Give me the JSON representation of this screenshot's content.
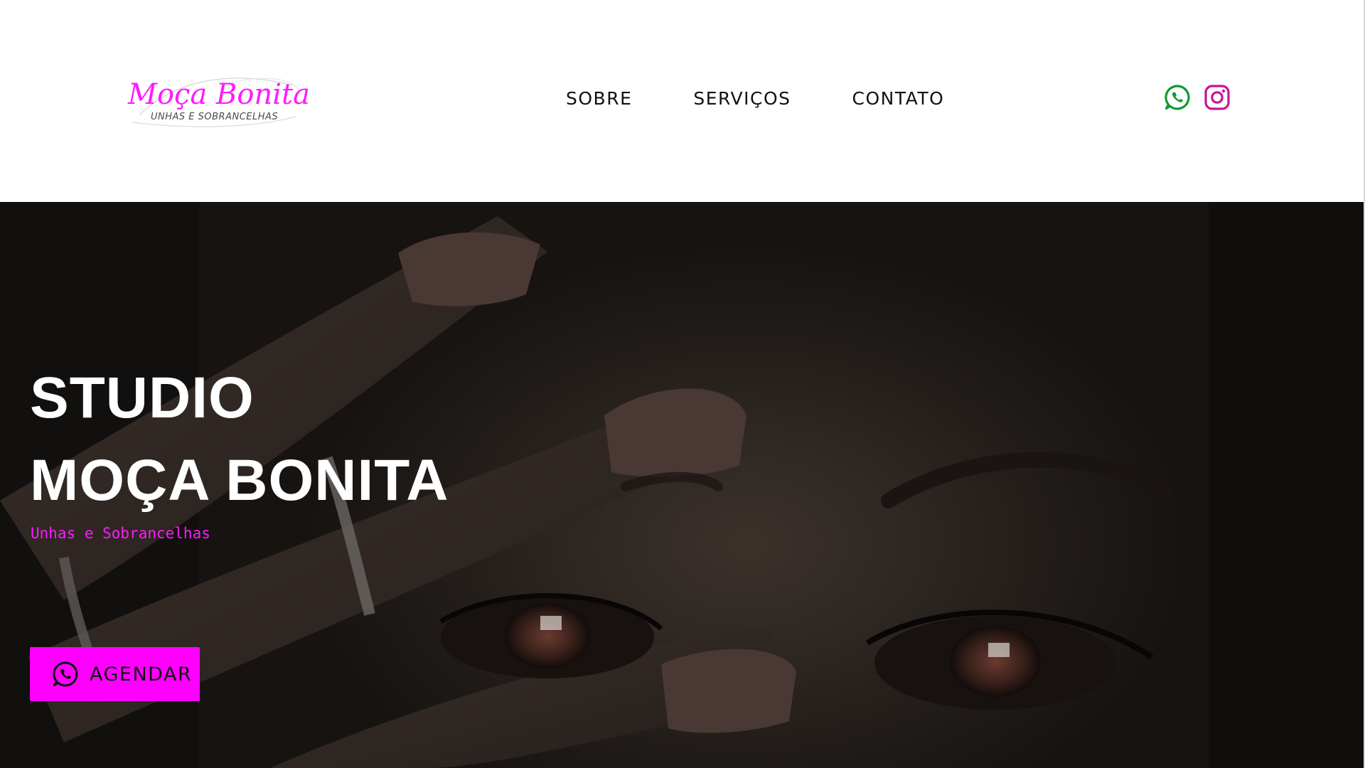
{
  "brand": {
    "title": "Moça Bonita",
    "tagline": "UNHAS E SOBRANCELHAS",
    "color": "#ff1aff"
  },
  "nav": {
    "items": [
      {
        "label": "SOBRE"
      },
      {
        "label": "SERVIÇOS"
      },
      {
        "label": "CONTATO"
      }
    ]
  },
  "social": {
    "whatsapp_icon": "whatsapp-icon",
    "whatsapp_color": "#0b9b2f",
    "instagram_icon": "instagram-icon",
    "instagram_color": "#c8139b"
  },
  "hero": {
    "title_line1": "STUDIO",
    "title_line2": "MOÇA BONITA",
    "subtitle": "Unhas e Sobrancelhas",
    "cta_label": "AGENDAR",
    "cta_icon": "whatsapp-icon",
    "cta_color": "#ff00ff"
  }
}
